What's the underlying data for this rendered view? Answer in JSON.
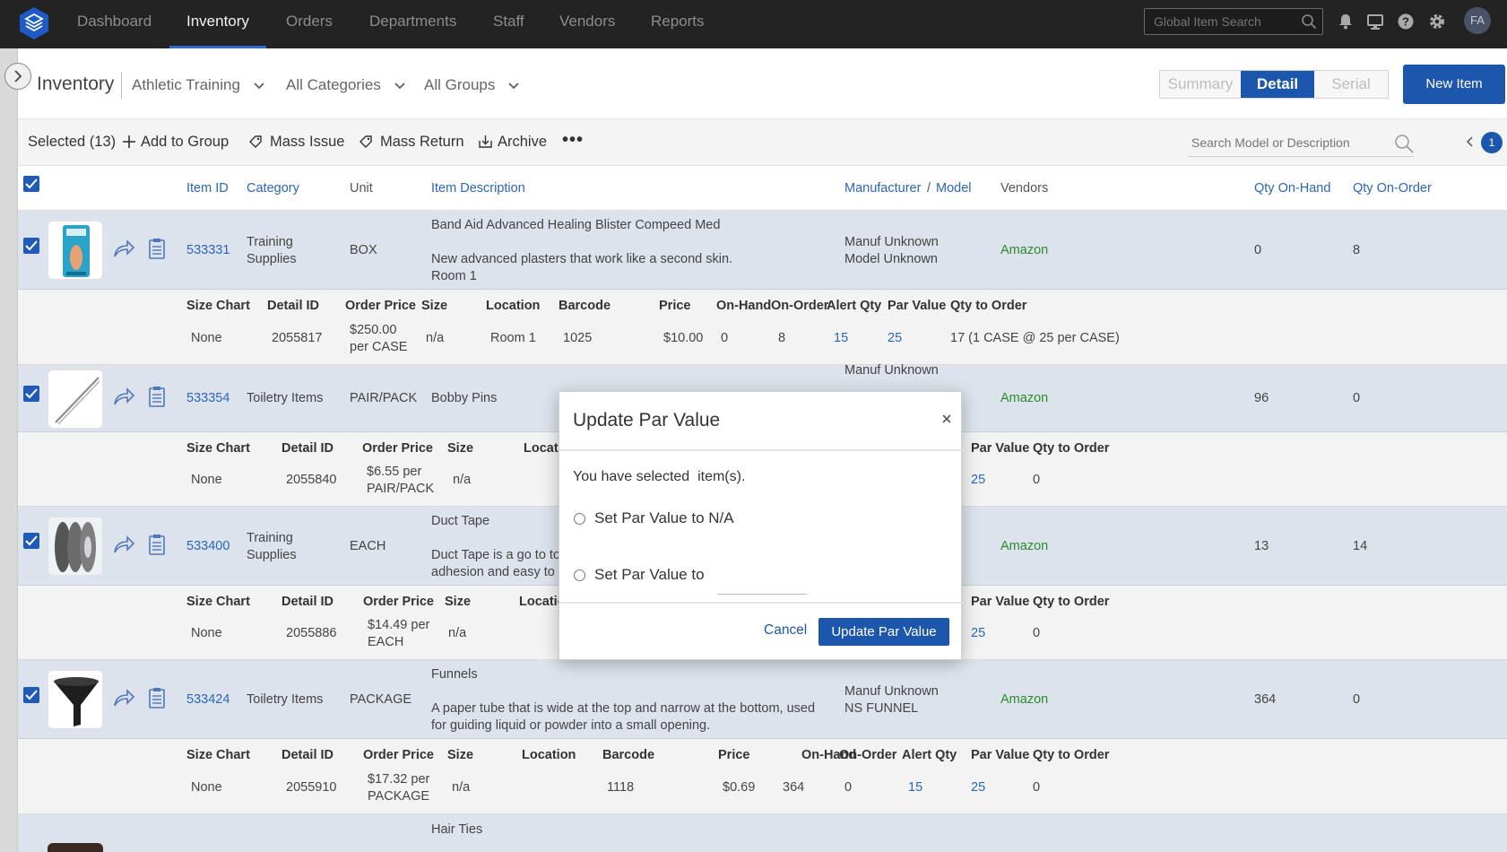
{
  "topnav": {
    "items": [
      {
        "label": "Dashboard"
      },
      {
        "label": "Inventory"
      },
      {
        "label": "Orders"
      },
      {
        "label": "Departments"
      },
      {
        "label": "Staff"
      },
      {
        "label": "Vendors"
      },
      {
        "label": "Reports"
      }
    ],
    "active": "Inventory",
    "search_placeholder": "Global Item Search",
    "avatar_initials": "FA",
    "icons": [
      "bell-icon",
      "monitor-icon",
      "help-icon",
      "gear-icon"
    ]
  },
  "header": {
    "title": "Inventory",
    "department": "Athletic Training",
    "category": "All Categories",
    "group": "All Groups",
    "views": [
      "Summary",
      "Detail",
      "Serial"
    ],
    "active_view": "Detail",
    "new_item_label": "New Item"
  },
  "toolbar": {
    "selected_label": "Selected (13)",
    "add_to_group": "Add to Group",
    "mass_issue": "Mass Issue",
    "mass_return": "Mass Return",
    "archive": "Archive",
    "more": "•••",
    "search_placeholder": "Search Model or Description",
    "page": "1"
  },
  "columns": {
    "item_id": "Item ID",
    "category": "Category",
    "unit": "Unit",
    "description": "Item Description",
    "manufacturer": "Manufacturer",
    "slash": "/",
    "model": "Model",
    "vendors": "Vendors",
    "qty_on_hand": "Qty On-Hand",
    "qty_on_order": "Qty On-Order"
  },
  "detail_headers": {
    "size_chart": "Size Chart",
    "detail_id": "Detail ID",
    "order_price": "Order Price",
    "size": "Size",
    "location": "Location",
    "barcode": "Barcode",
    "price": "Price",
    "on_hand": "On-Hand",
    "on_order": "On-Order",
    "alert_qty": "Alert Qty",
    "par_value": "Par Value",
    "qty_to_order": "Qty to Order"
  },
  "rows": [
    {
      "item_id": "533331",
      "category": "Training\nSupplies",
      "unit": "BOX",
      "description_title": "Band Aid Advanced Healing Blister Compeed Med",
      "description_body": "New advanced plasters that work like a second skin.\nRoom 1",
      "manufacturer": "Manuf Unknown",
      "model": "Model Unknown",
      "vendor": "Amazon",
      "qty_on_hand": "0",
      "qty_on_order": "8",
      "detail": {
        "size_chart": "None",
        "detail_id": "2055817",
        "order_price": "$250.00\nper CASE",
        "size": "n/a",
        "location": "Room 1",
        "barcode": "1025",
        "price": "$10.00",
        "on_hand": "0",
        "on_order": "8",
        "alert_qty": "15",
        "par_value": "25",
        "qty_to_order": "17 (1 CASE @ 25 per CASE)"
      }
    },
    {
      "item_id": "533354",
      "category": "Toiletry Items",
      "unit": "PAIR/PACK",
      "description_title": "Bobby Pins",
      "manufacturer_partial": "Manuf Unknown",
      "vendor": "Amazon",
      "qty_on_hand": "96",
      "qty_on_order": "0",
      "detail": {
        "size_chart": "None",
        "detail_id": "2055840",
        "order_price": "$6.55 per\nPAIR/PACK",
        "size": "n/a",
        "location_partial": "Locati",
        "par_value": "25",
        "qty_to_order": "0"
      }
    },
    {
      "item_id": "533400",
      "category": "Training\nSupplies",
      "unit": "EACH",
      "description_title": "Duct Tape",
      "description_body": "Duct Tape is a go to to\nadhesion and easy to",
      "vendor": "Amazon",
      "qty_on_hand": "13",
      "qty_on_order": "14",
      "detail": {
        "size_chart": "None",
        "detail_id": "2055886",
        "order_price": "$14.49 per\nEACH",
        "size": "n/a",
        "location_partial": "Locatio",
        "par_value": "25",
        "qty_to_order": "0"
      }
    },
    {
      "item_id": "533424",
      "category": "Toiletry Items",
      "unit": "PACKAGE",
      "description_title": "Funnels",
      "description_body": "A paper tube that is wide at the top and narrow at the bottom, used\nfor guiding liquid or powder into a small opening.",
      "manufacturer": "Manuf Unknown",
      "model": "NS FUNNEL",
      "vendor": "Amazon",
      "qty_on_hand": "364",
      "qty_on_order": "0",
      "detail": {
        "size_chart": "None",
        "detail_id": "2055910",
        "order_price": "$17.32 per\nPACKAGE",
        "size": "n/a",
        "location": "",
        "barcode": "1118",
        "price": "$0.69",
        "on_hand": "364",
        "on_order": "0",
        "alert_qty": "15",
        "par_value": "25",
        "qty_to_order": "0"
      }
    },
    {
      "description_title": "Hair Ties"
    }
  ],
  "modal": {
    "title": "Update Par Value",
    "message": "You have selected  item(s).",
    "option_na": "Set Par Value to N/A",
    "option_value": "Set Par Value to",
    "input_value": "",
    "cancel_label": "Cancel",
    "submit_label": "Update Par Value"
  },
  "colors": {
    "topbar": "#232323",
    "accent": "#1c57ad",
    "link": "#2a66b8",
    "vendor_green": "#2b8a2b",
    "row_selected": "#dde3ec",
    "detail_bg": "#f3f3f3"
  }
}
